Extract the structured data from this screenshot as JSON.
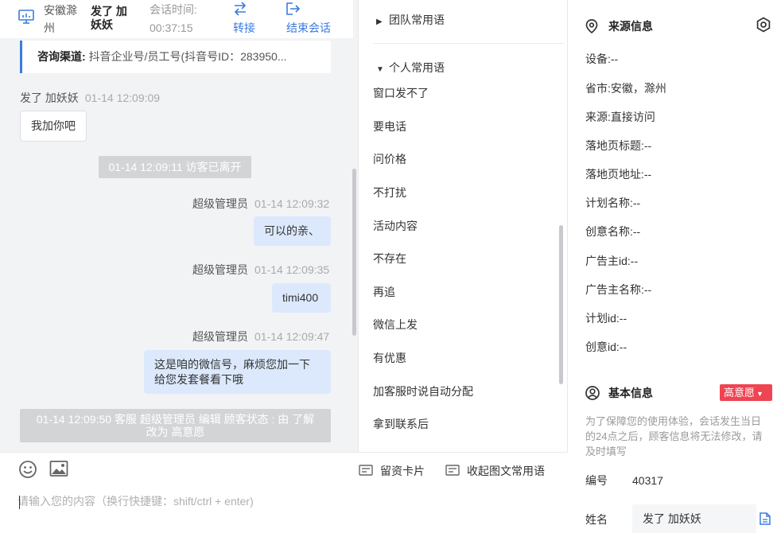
{
  "header": {
    "location": "安徽滁州",
    "visitor_name": "发了 加妖妖",
    "session_time_label": "会话时间:",
    "session_time_value": "00:37:15",
    "transfer_label": "转接",
    "end_session_label": "结束会话"
  },
  "channel": {
    "label": "咨询渠道:",
    "value": "抖音企业号/员工号(抖音号ID：283950..."
  },
  "messages": {
    "m1_sender": "发了 加妖妖",
    "m1_time": "01-14 12:09:09",
    "m1_text": "我加你吧",
    "sys1": "01-14 12:09:11 访客已离开",
    "m2_sender": "超级管理员",
    "m2_time": "01-14 12:09:32",
    "m2_text": "可以的亲、",
    "m3_sender": "超级管理员",
    "m3_time": "01-14 12:09:35",
    "m3_text": "timi400",
    "m4_sender": "超级管理员",
    "m4_time": "01-14 12:09:47",
    "m4_line1": "这是咱的微信号，麻烦您加一下",
    "m4_line2": "给您发套餐看下哦",
    "sys2_line1": "01-14 12:09:50 客服 超级管理员 编辑 顾客状态 : 由 了解",
    "sys2_line2": "改为 高意愿"
  },
  "phrases": {
    "team_group": "团队常用语",
    "personal_group": "个人常用语",
    "items": [
      "窗口发不了",
      "要电话",
      "问价格",
      "不打扰",
      "活动内容",
      "不存在",
      "再追",
      "微信上发",
      "有优惠",
      "加客服时说自动分配",
      "拿到联系后"
    ]
  },
  "input": {
    "leave_card_label": "留资卡片",
    "collapse_phrases_label": "收起图文常用语",
    "placeholder": "请输入您的内容（换行快捷键：shift/ctrl + enter)"
  },
  "source_info": {
    "title": "来源信息",
    "rows": [
      {
        "label": "设备:",
        "value": "--"
      },
      {
        "label": "省市:",
        "value": "安徽，滁州"
      },
      {
        "label": "来源:",
        "value": "直接访问"
      },
      {
        "label": "落地页标题:",
        "value": "--"
      },
      {
        "label": "落地页地址:",
        "value": "--"
      },
      {
        "label": "计划名称:",
        "value": "--"
      },
      {
        "label": "创意名称:",
        "value": "--"
      },
      {
        "label": "广告主id:",
        "value": "--"
      },
      {
        "label": "广告主名称:",
        "value": "--"
      },
      {
        "label": "计划id:",
        "value": "--"
      },
      {
        "label": "创意id:",
        "value": "--"
      }
    ]
  },
  "basic_info": {
    "title": "基本信息",
    "intent_badge": "高意愿",
    "notice": "为了保障您的使用体验，会话发生当日的24点之后，顾客信息将无法修改，请及时填写",
    "id_label": "编号",
    "id_value": "40317",
    "name_label": "姓名",
    "name_value": "发了 加妖妖"
  },
  "colors": {
    "accent": "#3a7be0",
    "agent_bubble": "#dce9fc",
    "badge_red": "#ef4452",
    "chat_bg": "#f2f3f5"
  }
}
